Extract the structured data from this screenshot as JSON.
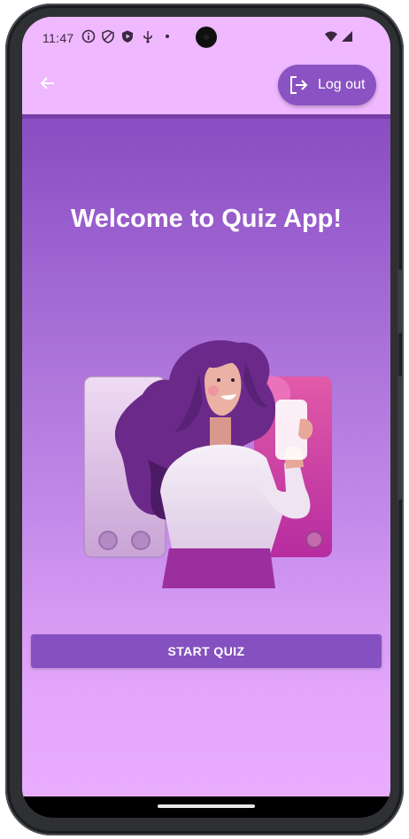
{
  "status_bar": {
    "time": "11:47",
    "left_icons": [
      "info-icon",
      "shield-icon",
      "play-protect-icon",
      "usb-icon",
      "dot-icon"
    ],
    "right_icons": [
      "wifi-icon",
      "signal-icon"
    ]
  },
  "app_bar": {
    "back_icon": "arrow-left-icon",
    "logout_label": "Log out",
    "logout_icon": "logout-icon"
  },
  "main": {
    "title": "Welcome to Quiz App!",
    "illustration": "woman-holding-phone-illustration",
    "start_button_label": "START QUIZ"
  },
  "colors": {
    "status_bar_bg": "#efb8ff",
    "gradient_top": "#8a4cc2",
    "gradient_bottom": "#e9acfd",
    "button_primary": "#8550bf",
    "logout_button": "#8a52c2"
  }
}
